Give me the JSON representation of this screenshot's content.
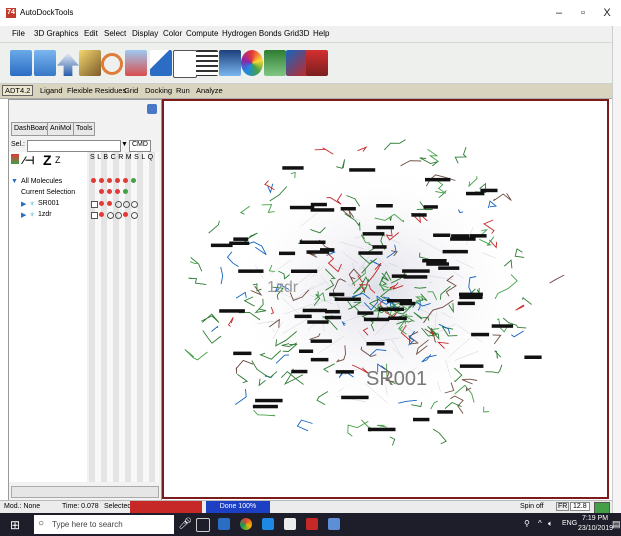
{
  "window": {
    "title": "AutoDockTools",
    "icon_text": "74"
  },
  "menu": [
    "File",
    "3D Graphics",
    "Edit",
    "Select",
    "Display",
    "Color",
    "Compute",
    "Hydrogen Bonds",
    "Grid3D",
    "Help"
  ],
  "tabs": [
    "ADT4.2",
    "Ligand",
    "Flexible Residues",
    "Grid",
    "Docking",
    "Run",
    "Analyze"
  ],
  "panel": {
    "subtabs": [
      "DashBoard",
      "AniMol",
      "Tools"
    ],
    "select_label": "Sel.:",
    "cmd_label": "CMD",
    "column_headers": "S L B C R M S L Q",
    "tree": [
      "All Molecules",
      "Current Selection",
      "SR001",
      "1zdr"
    ]
  },
  "viewer": {
    "labels": [
      "SR001",
      "1zdr"
    ]
  },
  "status": {
    "mod": "Mod.: None",
    "time": "Time: 0.078",
    "selected": "Selected",
    "done": "Done 100%",
    "spin": "Spin off",
    "fr_label": "FR",
    "fr_value": "12.8"
  },
  "taskbar": {
    "search_placeholder": "Type here to search",
    "lang": "ENG",
    "time": "7:19 PM",
    "date": "23/10/2019"
  },
  "colors": {
    "viewer_border": "#7d1a1a",
    "tabs_bg": "#d9d4bd",
    "taskbar_bg": "#1e1e2a"
  }
}
